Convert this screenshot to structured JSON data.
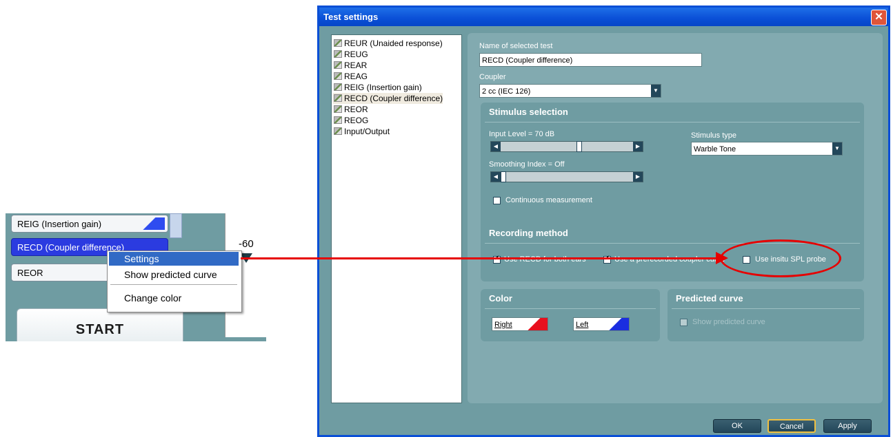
{
  "snippet": {
    "list_items": [
      "REIG (Insertion gain)",
      "RECD (Coupler difference)",
      "REOR"
    ],
    "graph_tick": "-60",
    "start_label": "START",
    "context_menu": [
      "Settings",
      "Show predicted curve",
      "Change color"
    ]
  },
  "dialog": {
    "title": "Test settings",
    "close_symbol": "✕",
    "tests": [
      "REUR (Unaided response)",
      "REUG",
      "REAR",
      "REAG",
      "REIG (Insertion gain)",
      "RECD (Coupler difference)",
      "REOR",
      "REOG",
      "Input/Output"
    ],
    "selected_test_index": 5,
    "name_label": "Name of selected test",
    "name_value": "RECD (Coupler difference)",
    "coupler_label": "Coupler",
    "coupler_value": "2 cc (IEC 126)",
    "stimulus": {
      "title": "Stimulus selection",
      "input_level_label": "Input Level = 70 dB",
      "input_level_fraction": 0.6,
      "smoothing_label": "Smoothing Index = Off",
      "smoothing_fraction": 0.0,
      "stimulus_type_label": "Stimulus type",
      "stimulus_type_value": "Warble Tone",
      "continuous_label": "Continuous measurement",
      "continuous_checked": false
    },
    "recording": {
      "title": "Recording method",
      "use_recd_both": "Use RECD for both ears",
      "use_recd_both_checked": true,
      "use_prerecorded": "Use a prerecorded coupler curve",
      "use_prerecorded_checked": true,
      "use_insitu": "Use insitu SPL probe",
      "use_insitu_checked": false
    },
    "color": {
      "title": "Color",
      "right_label": "Right",
      "left_label": "Left",
      "right_color": "#e8101e",
      "left_color": "#1a2de0"
    },
    "predicted": {
      "title": "Predicted curve",
      "show_label": "Show predicted curve",
      "checked": false
    },
    "buttons": {
      "ok": "OK",
      "cancel": "Cancel",
      "apply": "Apply"
    }
  },
  "annotation": {
    "color": "#e60000"
  }
}
